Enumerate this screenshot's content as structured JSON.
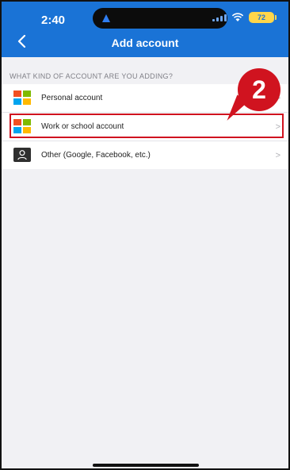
{
  "status_bar": {
    "time": "2:40",
    "battery": "72"
  },
  "header": {
    "title": "Add account",
    "back_icon": "chevron-left-icon"
  },
  "section": {
    "header": "WHAT KIND OF ACCOUNT ARE YOU ADDING?"
  },
  "accounts": [
    {
      "label": "Personal account",
      "icon": "microsoft-logo-icon",
      "chevron": ">"
    },
    {
      "label": "Work or school account",
      "icon": "microsoft-logo-icon",
      "chevron": ">"
    },
    {
      "label": "Other (Google, Facebook, etc.)",
      "icon": "user-icon",
      "chevron": ">"
    }
  ],
  "annotation": {
    "step": "2"
  },
  "colors": {
    "header_bg": "#1a73d6",
    "annotation": "#d0131f",
    "ms_red": "#f25022",
    "ms_green": "#7fba00",
    "ms_blue": "#00a4ef",
    "ms_yellow": "#ffb900"
  }
}
